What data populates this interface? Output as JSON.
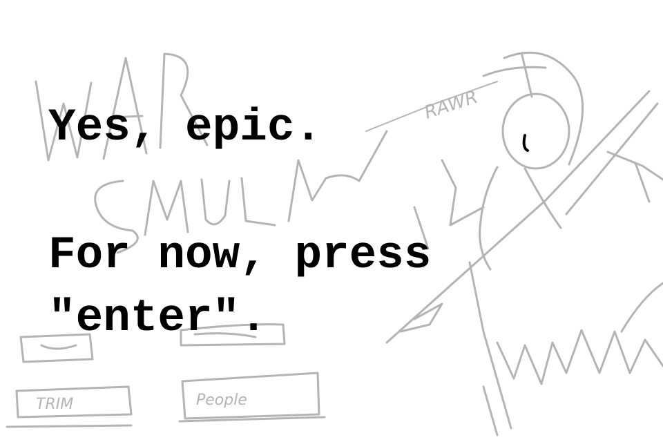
{
  "dialog": {
    "lines": [
      "Yes, epic.",
      "For now, press",
      "\"enter\"."
    ]
  },
  "sketch": {
    "scribbles": [
      "WAR",
      "SIMULA",
      "RAWR",
      "TRIM",
      "People"
    ],
    "color": "#b4b4b4"
  },
  "colors": {
    "background": "#ffffff",
    "text": "#000000",
    "sketch": "#b4b4b4"
  }
}
